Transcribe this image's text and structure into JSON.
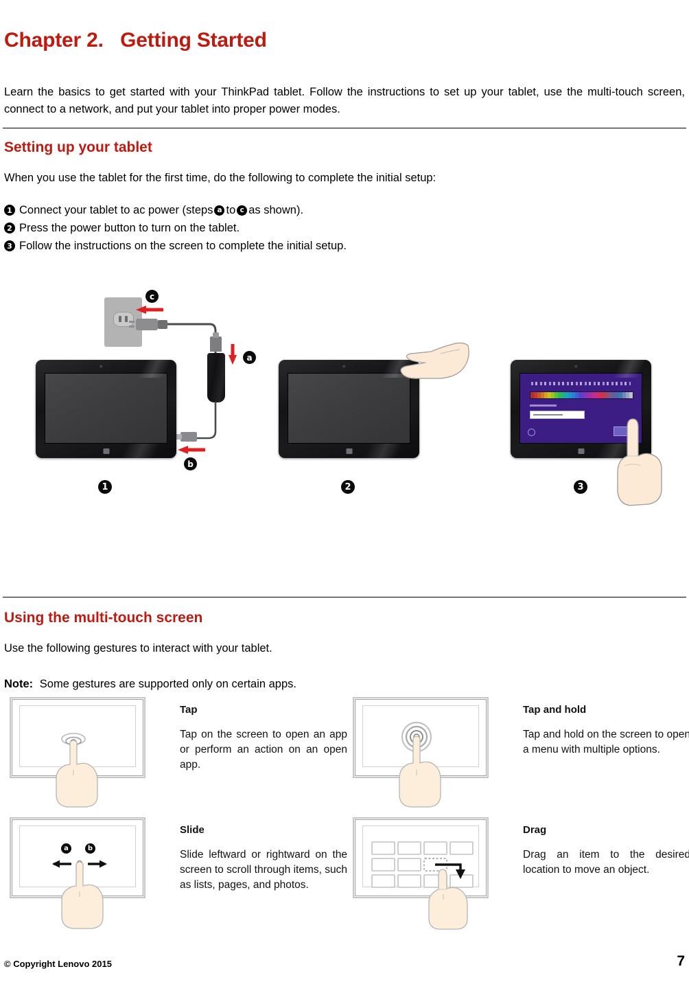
{
  "document": {
    "chapter_title": "Chapter 2.   Getting Started",
    "intro": "Learn the basics to get started with your ThinkPad tablet. Follow the instructions to set up your tablet, use the multi-touch screen, connect to a network, and put your tablet into proper power modes."
  },
  "setup_section": {
    "heading": "Setting up your tablet",
    "lead": "When you use the tablet for the first time, do the following to complete the initial setup:",
    "steps": [
      {
        "number": "1",
        "text_before": "Connect your tablet to ac power (steps",
        "tag_a": "a",
        "text_middle": "to",
        "tag_b": "c",
        "text_after": "as shown)."
      },
      {
        "number": "2",
        "text": "Press the power button to turn on the tablet."
      },
      {
        "number": "3",
        "text": "Follow the instructions on the screen to complete the initial setup."
      }
    ],
    "figure": {
      "panel_labels": [
        "1",
        "2",
        "3"
      ],
      "connection_tags": [
        "a",
        "b",
        "c"
      ],
      "swatch_colors": [
        "#b03030",
        "#c23a3a",
        "#c85a2a",
        "#d07a22",
        "#d8a41e",
        "#c9c41c",
        "#97c42a",
        "#5cc03a",
        "#2fba55",
        "#21b184",
        "#1aa7ad",
        "#1f96c7",
        "#2a7fd4",
        "#3a63d8",
        "#5044d0",
        "#6d3ac4",
        "#8a32b8",
        "#a52ea8",
        "#bd2c93",
        "#cc2c78",
        "#d2305c",
        "#c8384a",
        "#9a4a6a",
        "#7a5a8c",
        "#5f5f9e",
        "#4a6aa8",
        "#3d7ab0",
        "#6a8ab8",
        "#9aa0c0",
        "#c0c0cc"
      ]
    }
  },
  "touch_section": {
    "heading": "Using the multi-touch screen",
    "lead": "Use the following gestures to interact with your tablet.",
    "note_label": "Note:",
    "note_text": "Some gestures are supported only on certain apps.",
    "gestures": [
      {
        "title": "Tap",
        "description": "Tap on the screen to open an app or perform an action on an open app.",
        "icon": "tap-gesture-icon"
      },
      {
        "title": "Tap and hold",
        "description": "Tap and hold on the screen to open a menu with multiple options.",
        "icon": "tap-and-hold-gesture-icon"
      },
      {
        "title": "Slide",
        "description": "Slide leftward or rightward on the screen to scroll through items, such as lists, pages, and photos.",
        "icon": "slide-gesture-icon",
        "markers": [
          "a",
          "b"
        ]
      },
      {
        "title": "Drag",
        "description": "Drag an item to the desired location to move an object.",
        "icon": "drag-gesture-icon"
      }
    ]
  },
  "footer": {
    "copyright": "© Copyright Lenovo 2015",
    "page_number": "7"
  },
  "colors": {
    "heading_red": "#BE1A10",
    "arrow_red": "#E02020",
    "body_black": "#000000",
    "boot_screen_purple": "#3C1D84"
  }
}
